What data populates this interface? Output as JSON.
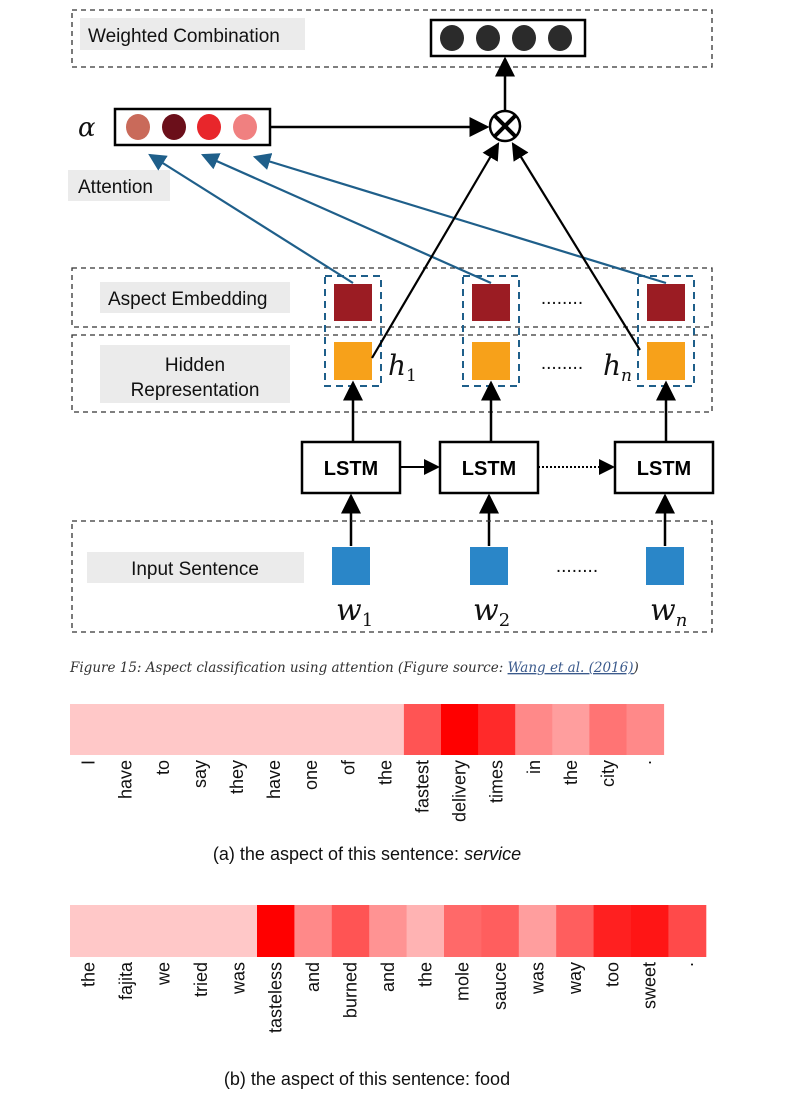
{
  "diagram": {
    "weighted_combination_label": "Weighted Combination",
    "alpha_symbol": "α",
    "attention_label": "Attention",
    "aspect_embedding_label": "Aspect Embedding",
    "hidden_label_line1": "Hidden",
    "hidden_label_line2": "Representation",
    "lstm_label": "LSTM",
    "input_sentence_label": "Input Sentence",
    "ellipsis": "........",
    "h1": "h",
    "h1_sub": "1",
    "hn": "h",
    "hn_sub": "n",
    "w1": "w",
    "w1_sub": "1",
    "w2": "w",
    "w2_sub": "2",
    "wn": "w",
    "wn_sub": "n",
    "alpha_colors": [
      "#c96a5a",
      "#6b0f1a",
      "#e8262b",
      "#f08080"
    ],
    "output_color": "#2b2b2b",
    "aspect_color": "#9b1c23",
    "hidden_color": "#f7a11a",
    "input_color": "#2a86c8",
    "attention_arrow_color": "#1f5f8a"
  },
  "caption": {
    "text": "Figure 15: Aspect classification using attention (Figure source: ",
    "link": "Wang et al. (2016)",
    "close": ")",
    "link_color": "#3b5a8c"
  },
  "chart_data": [
    {
      "type": "heatmap",
      "tokens": [
        "I",
        "have",
        "to",
        "say",
        "they",
        "have",
        "one",
        "of",
        "the",
        "fastest",
        "delivery",
        "times",
        "in",
        "the",
        "city",
        "."
      ],
      "values": [
        0.05,
        0.05,
        0.05,
        0.05,
        0.05,
        0.05,
        0.05,
        0.05,
        0.05,
        0.6,
        1.0,
        0.8,
        0.35,
        0.25,
        0.45,
        0.35
      ],
      "caption_prefix": "(a) the aspect of this sentence: ",
      "caption_aspect": "service"
    },
    {
      "type": "heatmap",
      "tokens": [
        "the",
        "fajita",
        "we",
        "tried",
        "was",
        "tasteless",
        "and",
        "burned",
        "and",
        "the",
        "mole",
        "sauce",
        "was",
        "way",
        "too",
        "sweet",
        "."
      ],
      "values": [
        0.05,
        0.05,
        0.05,
        0.05,
        0.05,
        1.0,
        0.35,
        0.6,
        0.3,
        0.15,
        0.5,
        0.55,
        0.25,
        0.55,
        0.85,
        0.9,
        0.65
      ],
      "caption_prefix": "(b) the aspect of this sentence: food",
      "caption_aspect": ""
    }
  ]
}
